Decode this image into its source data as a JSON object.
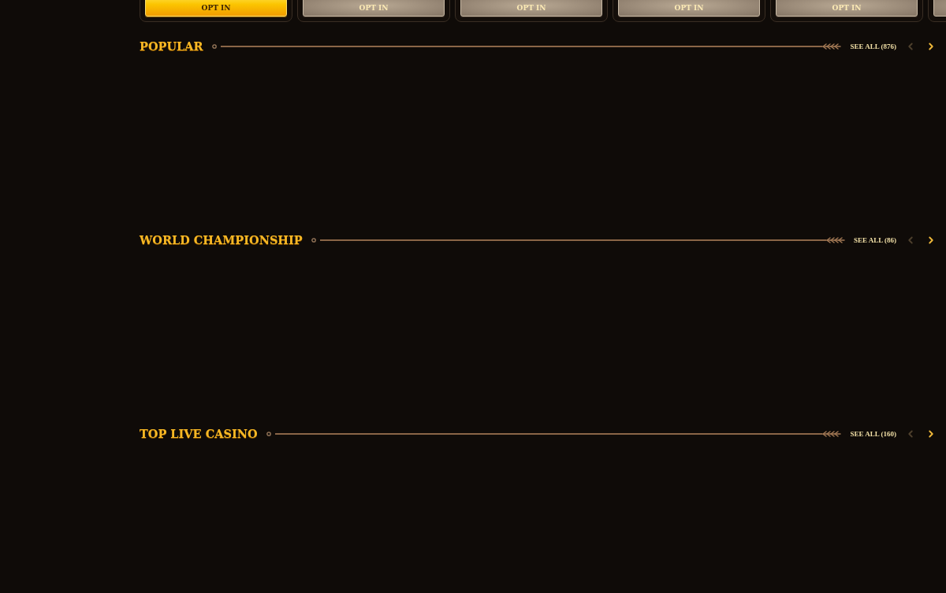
{
  "promotions": [
    {
      "button": "OPT IN",
      "selected": true
    },
    {
      "button": "OPT IN",
      "selected": false
    },
    {
      "button": "OPT IN",
      "selected": false
    },
    {
      "button": "OPT IN",
      "selected": false
    },
    {
      "button": "OPT IN",
      "selected": false
    }
  ],
  "sections": [
    {
      "title": "POPULAR",
      "see_all": "SEE ALL (876)",
      "prev": {
        "disabled": true
      },
      "next": {
        "disabled": false
      }
    },
    {
      "title": "WORLD CHAMPIONSHIP",
      "see_all": "SEE ALL (86)",
      "prev": {
        "disabled": true
      },
      "next": {
        "disabled": false
      }
    },
    {
      "title": "TOP LIVE CASINO",
      "see_all": "SEE ALL (160)",
      "prev": {
        "disabled": true
      },
      "next": {
        "disabled": false
      }
    }
  ]
}
